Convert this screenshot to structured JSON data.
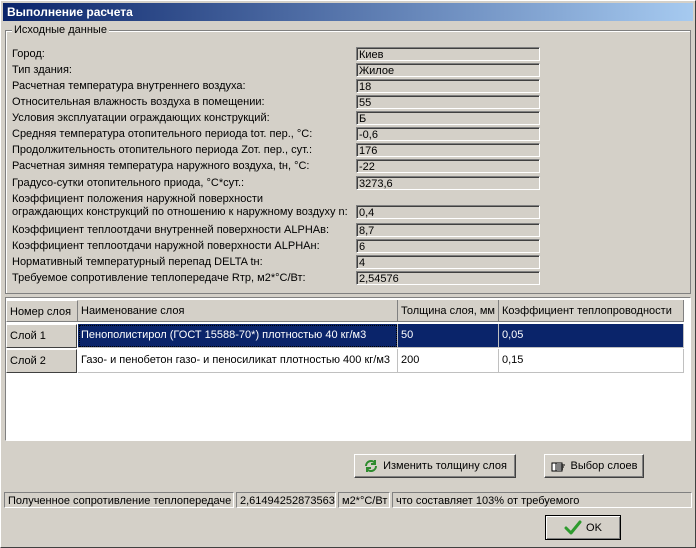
{
  "window": {
    "title": "Выполнение расчета"
  },
  "group": {
    "title": "Исходные данные",
    "params": [
      {
        "label": "Город:",
        "value": "Киев"
      },
      {
        "label": "Тип здания:",
        "value": "Жилое"
      },
      {
        "label": "Расчетная температура внутреннего воздуха:",
        "value": "18"
      },
      {
        "label": "Относительная влажность воздуха в помещении:",
        "value": "55"
      },
      {
        "label": "Условия эксплуатации ограждающих конструкций:",
        "value": "Б"
      },
      {
        "label": "Средняя температура отопительного периода tот. пер., °С:",
        "value": "-0,6"
      },
      {
        "label": "Продолжительность отопительного периода Zот. пер., сут.:",
        "value": "176"
      },
      {
        "label": "Расчетная зимняя температура наружного воздуха, tн, °С:",
        "value": "-22"
      },
      {
        "label": "Градусо-сутки отопительного приода, °С*сут.:",
        "value": "3273,6"
      },
      {
        "label_line1": "Коэффициент положения наружной поверхности",
        "label_line2": "ограждающих конструкций по отношению к наружному воздуху n:",
        "value": "0,4"
      },
      {
        "label": "Коэффициент теплоотдачи внутренней поверхности ALPHAв:",
        "value": "8,7"
      },
      {
        "label": "Коэффициент теплоотдачи наружной поверхности ALPHAн:",
        "value": "6"
      },
      {
        "label": "Нормативный температурный перепад DELTA tн:",
        "value": "4"
      },
      {
        "label": "Требуемое сопротивление теплопередаче Rтр, м2*°С/Вт:",
        "value": "2,54576"
      }
    ]
  },
  "table": {
    "columns": [
      "Номер слоя",
      "Наименование слоя",
      "Толщина слоя, мм",
      "Коэффициент теплопроводности"
    ],
    "rows": [
      {
        "num": "Слой 1",
        "name": "Пенополистирол (ГОСТ 15588-70*) плотностью 40 кг/м3",
        "thickness": "50",
        "coef": "0,05"
      },
      {
        "num": "Слой 2",
        "name": "Газо- и пенобетон газо- и пеносиликат плотностью 400 кг/м3",
        "thickness": "200",
        "coef": "0,15"
      }
    ]
  },
  "buttons": {
    "change_thickness": "Изменить толщину слоя",
    "select_layers": "Выбор слоев",
    "ok": "OK"
  },
  "status": {
    "label": "Полученное сопротивление теплопередаче",
    "value": "2,61494252873563",
    "unit": "м2*°С/Вт",
    "note": "что составляет 103% от требуемого"
  },
  "colors": {
    "selection": "#0a246a",
    "titlebar_start": "#0a246a",
    "titlebar_end": "#a6caf0"
  }
}
